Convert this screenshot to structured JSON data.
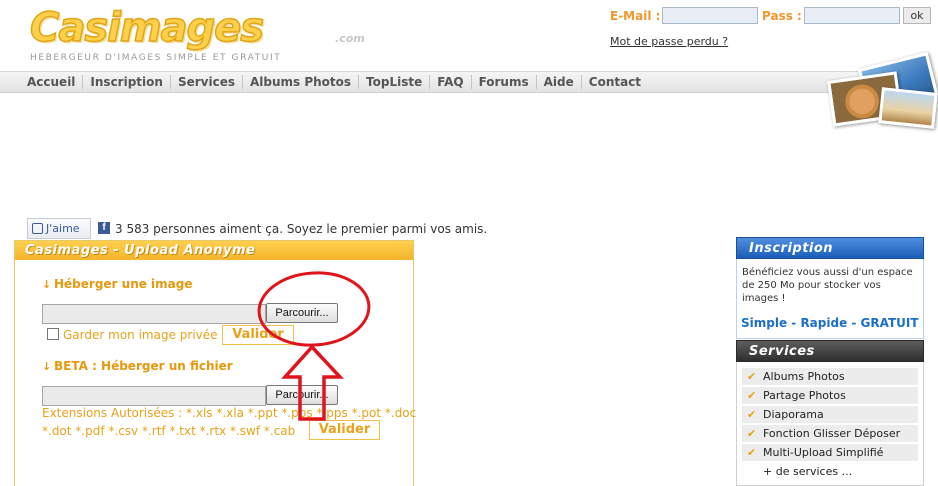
{
  "header": {
    "logo_text": "Casimages",
    "logo_suffix": ".com",
    "tagline": "HEBERGEUR D'IMAGES SIMPLE ET GRATUIT"
  },
  "login": {
    "email_label": "E-Mail :",
    "pass_label": "Pass :",
    "ok_label": "ok",
    "lost_password": "Mot de passe perdu ?"
  },
  "nav": {
    "items": [
      "Accueil",
      "Inscription",
      "Services",
      "Albums Photos",
      "TopListe",
      "FAQ",
      "Forums",
      "Aide",
      "Contact"
    ]
  },
  "social": {
    "like_label": "J'aime",
    "fb_letter": "f",
    "like_text": "3 583 personnes aiment ça. Soyez le premier parmi vos amis."
  },
  "upload": {
    "title": "Casimages - Upload Anonyme",
    "image_section": "Héberger une image",
    "browse_label": "Parcourir...",
    "private_label": "Garder mon image privée",
    "valider_label": "Valider",
    "file_section": "BETA : Héberger un fichier",
    "ext_line1": "Extensions Autorisées : *.xls *.xla *.ppt *.pps *.pps *.pot *.doc",
    "ext_line2": "*.dot *.pdf *.csv *.rtf *.txt *.rtx *.swf *.cab"
  },
  "inscription_box": {
    "title": "Inscription",
    "text": "Bénéficiez vous aussi d'un espace de 250 Mo pour stocker vos images !",
    "tagline": "Simple - Rapide - GRATUIT"
  },
  "services_box": {
    "title": "Services",
    "items": [
      "Albums Photos",
      "Partage Photos",
      "Diaporama",
      "Fonction Glisser Déposer",
      "Multi-Upload Simplifié"
    ],
    "more": "+ de services ..."
  },
  "colors": {
    "accent_orange": "#f0962b",
    "annotation_red": "#e0141c",
    "inscription_blue": "#1c5eb8"
  }
}
